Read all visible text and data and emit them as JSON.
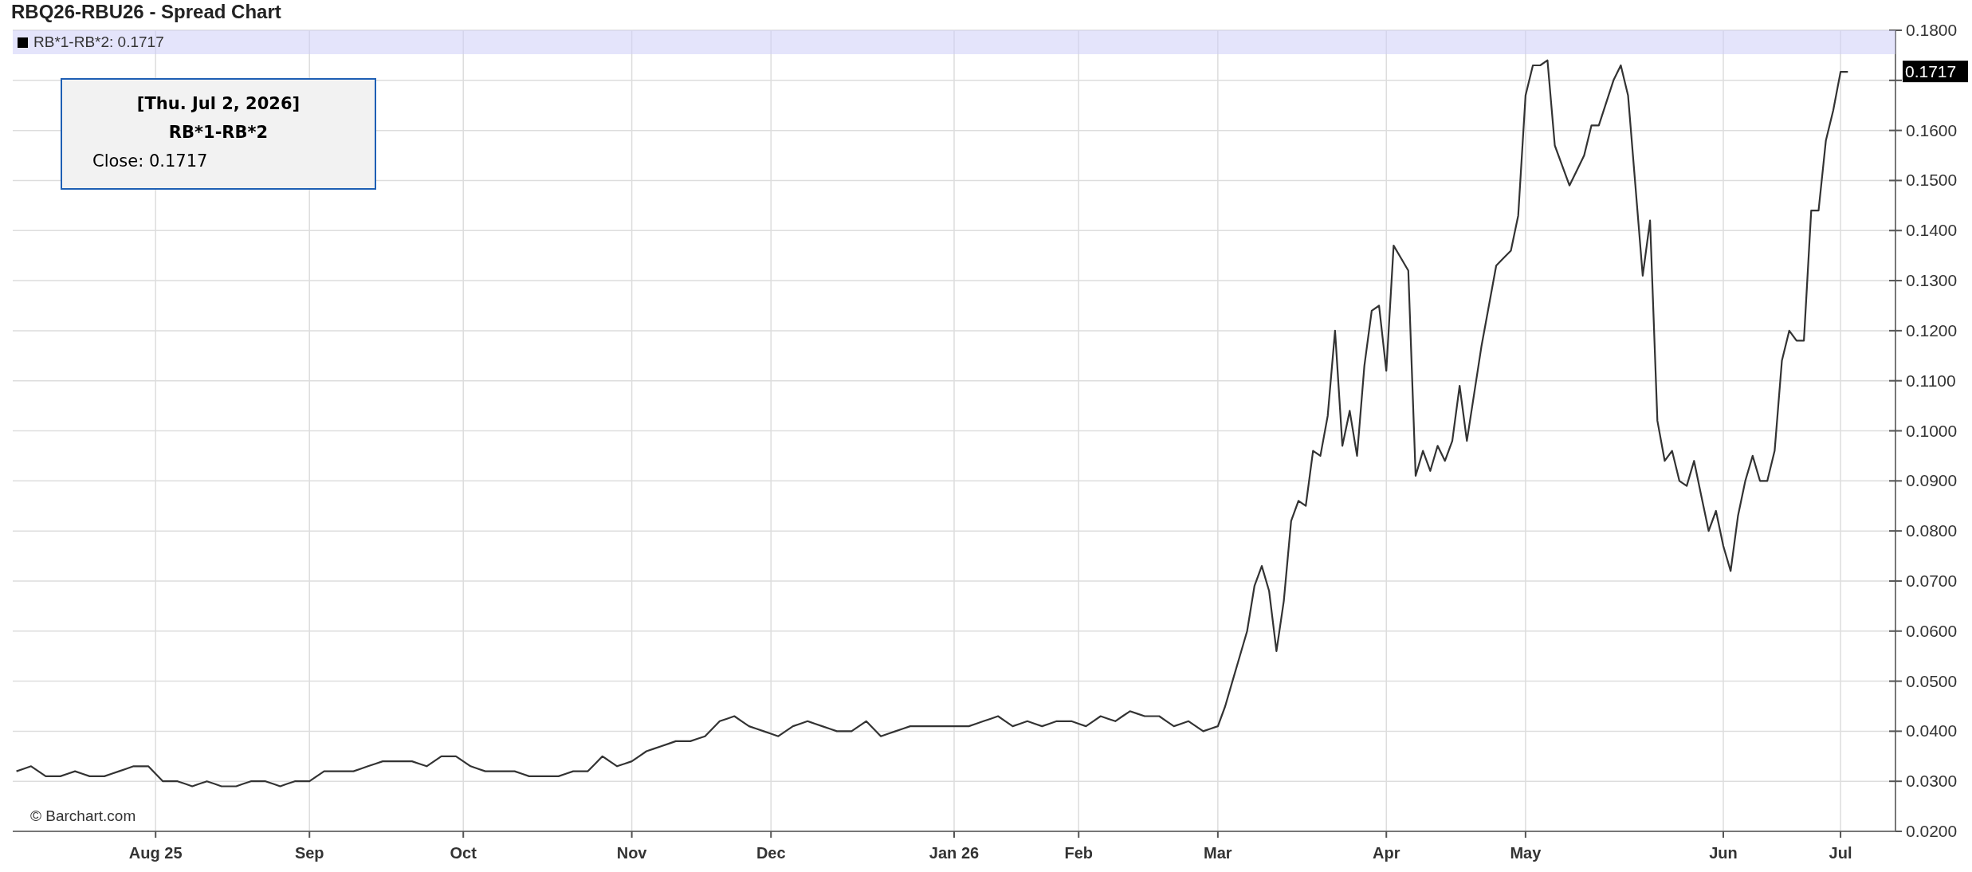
{
  "title": "RBQ26-RBU26 - Spread Chart",
  "legend": {
    "label": "RB*1-RB*2: 0.1717"
  },
  "tooltip": {
    "date": "[Thu. Jul 2, 2026]",
    "close": "Close: 0.1717"
  },
  "last_value_label": "0.1717",
  "credit": "© Barchart.com",
  "chart_data": {
    "type": "line",
    "categories": [
      null,
      null,
      null,
      null,
      null,
      null,
      null,
      null,
      null,
      null,
      null,
      null,
      null,
      null,
      null,
      null,
      null,
      null,
      null,
      "Aug 25",
      null,
      null,
      null,
      null,
      null,
      null,
      null,
      null,
      null,
      null,
      null,
      null,
      null,
      null,
      null,
      null,
      null,
      null,
      null,
      null,
      "Sep",
      null,
      null,
      null,
      null,
      null,
      null,
      null,
      null,
      null,
      null,
      null,
      null,
      null,
      null,
      null,
      null,
      null,
      null,
      null,
      null,
      "Oct",
      null,
      null,
      null,
      null,
      null,
      null,
      null,
      null,
      null,
      null,
      null,
      null,
      null,
      null,
      null,
      null,
      null,
      null,
      null,
      null,
      null,
      null,
      "Nov",
      null,
      null,
      null,
      null,
      null,
      null,
      null,
      null,
      null,
      null,
      null,
      null,
      null,
      null,
      null,
      null,
      null,
      null,
      "Dec",
      null,
      null,
      null,
      null,
      null,
      null,
      null,
      null,
      null,
      null,
      null,
      null,
      null,
      null,
      null,
      null,
      null,
      null,
      null,
      null,
      null,
      null,
      null,
      null,
      "Jan 26",
      null,
      null,
      null,
      null,
      null,
      null,
      null,
      null,
      null,
      null,
      null,
      null,
      null,
      null,
      null,
      null,
      "Feb",
      null,
      null,
      null,
      null,
      null,
      null,
      null,
      null,
      null,
      null,
      null,
      null,
      null,
      null,
      null,
      null,
      null,
      null,
      "Mar",
      null,
      null,
      null,
      null,
      null,
      null,
      null,
      null,
      null,
      null,
      null,
      null,
      null,
      null,
      null,
      null,
      null,
      null,
      null,
      null,
      null,
      null,
      "Apr",
      null,
      null,
      null,
      null,
      null,
      null,
      null,
      null,
      null,
      null,
      null,
      null,
      null,
      null,
      null,
      null,
      null,
      null,
      "May",
      null,
      null,
      null,
      null,
      null,
      null,
      null,
      null,
      null,
      null,
      null,
      null,
      null,
      null,
      null,
      null,
      null,
      null,
      null,
      null,
      null,
      null,
      null,
      null,
      null,
      null,
      "Jun",
      null,
      null,
      null,
      null,
      null,
      null,
      null,
      null,
      null,
      null,
      null,
      null,
      null,
      null,
      null,
      "Jul",
      null
    ],
    "series": [
      {
        "name": "RB*1-RB*2",
        "color": "#333333",
        "values": [
          0.032,
          0.0325,
          0.033,
          0.032,
          0.031,
          0.031,
          0.031,
          0.0315,
          0.032,
          0.0315,
          0.031,
          0.031,
          0.031,
          0.0315,
          0.032,
          0.0325,
          0.033,
          0.033,
          0.033,
          0.0315,
          0.03,
          0.03,
          0.03,
          0.0295,
          0.029,
          0.0295,
          0.03,
          0.0295,
          0.029,
          0.029,
          0.029,
          0.0295,
          0.03,
          0.03,
          0.03,
          0.0295,
          0.029,
          0.0295,
          0.03,
          0.03,
          0.03,
          0.031,
          0.032,
          0.032,
          0.032,
          0.032,
          0.032,
          0.0325,
          0.033,
          0.0335,
          0.034,
          0.034,
          0.034,
          0.034,
          0.034,
          0.0335,
          0.033,
          0.034,
          0.035,
          0.035,
          0.035,
          0.034,
          0.033,
          0.0325,
          0.032,
          0.032,
          0.032,
          0.032,
          0.032,
          0.0315,
          0.031,
          0.031,
          0.031,
          0.031,
          0.031,
          0.0315,
          0.032,
          0.032,
          0.032,
          0.0335,
          0.035,
          0.034,
          0.033,
          0.0335,
          0.034,
          0.035,
          0.036,
          0.0365,
          0.037,
          0.0375,
          0.038,
          0.038,
          0.038,
          0.0385,
          0.039,
          0.0405,
          0.042,
          0.0425,
          0.043,
          0.042,
          0.041,
          0.0405,
          0.04,
          0.0395,
          0.039,
          0.04,
          0.041,
          0.0415,
          0.042,
          0.0415,
          0.041,
          0.0405,
          0.04,
          0.04,
          0.04,
          0.041,
          0.042,
          0.0405,
          0.039,
          0.0395,
          0.04,
          0.0405,
          0.041,
          0.041,
          0.041,
          0.041,
          0.041,
          0.041,
          0.041,
          0.041,
          0.041,
          0.0415,
          0.042,
          0.0425,
          0.043,
          0.042,
          0.041,
          0.0415,
          0.042,
          0.0415,
          0.041,
          0.0415,
          0.042,
          0.042,
          0.042,
          0.0415,
          0.041,
          0.042,
          0.043,
          0.0425,
          0.042,
          0.043,
          0.044,
          0.0435,
          0.043,
          0.043,
          0.043,
          0.042,
          0.041,
          0.0415,
          0.042,
          0.041,
          0.04,
          0.0405,
          0.041,
          0.045,
          0.05,
          0.055,
          0.06,
          0.069,
          0.073,
          0.068,
          0.056,
          0.066,
          0.082,
          0.086,
          0.085,
          0.096,
          0.095,
          0.103,
          0.12,
          0.097,
          0.104,
          0.095,
          0.113,
          0.124,
          0.125,
          0.112,
          0.137,
          0.1345,
          0.132,
          0.091,
          0.096,
          0.092,
          0.097,
          0.094,
          0.098,
          0.109,
          0.098,
          0.1075,
          0.117,
          0.125,
          0.133,
          0.1345,
          0.136,
          0.143,
          0.167,
          0.173,
          0.173,
          0.174,
          0.157,
          0.153,
          0.149,
          0.152,
          0.155,
          0.161,
          0.161,
          0.1655,
          0.17,
          0.173,
          0.167,
          0.149,
          0.131,
          0.142,
          0.102,
          0.094,
          0.096,
          0.09,
          0.089,
          0.094,
          0.087,
          0.08,
          0.084,
          0.077,
          0.072,
          0.083,
          0.09,
          0.095,
          0.09,
          0.09,
          0.096,
          0.114,
          0.12,
          0.118,
          0.118,
          0.144,
          0.144,
          0.158,
          0.164,
          0.1717,
          0.1717
        ]
      }
    ],
    "grid": true,
    "ylim": [
      0.02,
      0.18
    ],
    "yticks": [
      {
        "value": 0.02,
        "label": "0.0200"
      },
      {
        "value": 0.03,
        "label": "0.0300"
      },
      {
        "value": 0.04,
        "label": "0.0400"
      },
      {
        "value": 0.05,
        "label": "0.0500"
      },
      {
        "value": 0.06,
        "label": "0.0600"
      },
      {
        "value": 0.07,
        "label": "0.0700"
      },
      {
        "value": 0.08,
        "label": "0.0800"
      },
      {
        "value": 0.09,
        "label": "0.0900"
      },
      {
        "value": 0.1,
        "label": "0.1000"
      },
      {
        "value": 0.11,
        "label": "0.1100"
      },
      {
        "value": 0.12,
        "label": "0.1200"
      },
      {
        "value": 0.13,
        "label": "0.1300"
      },
      {
        "value": 0.14,
        "label": "0.1400"
      },
      {
        "value": 0.15,
        "label": "0.1500"
      },
      {
        "value": 0.16,
        "label": "0.1600"
      },
      {
        "value": 0.18,
        "label": "0.1800"
      }
    ]
  }
}
